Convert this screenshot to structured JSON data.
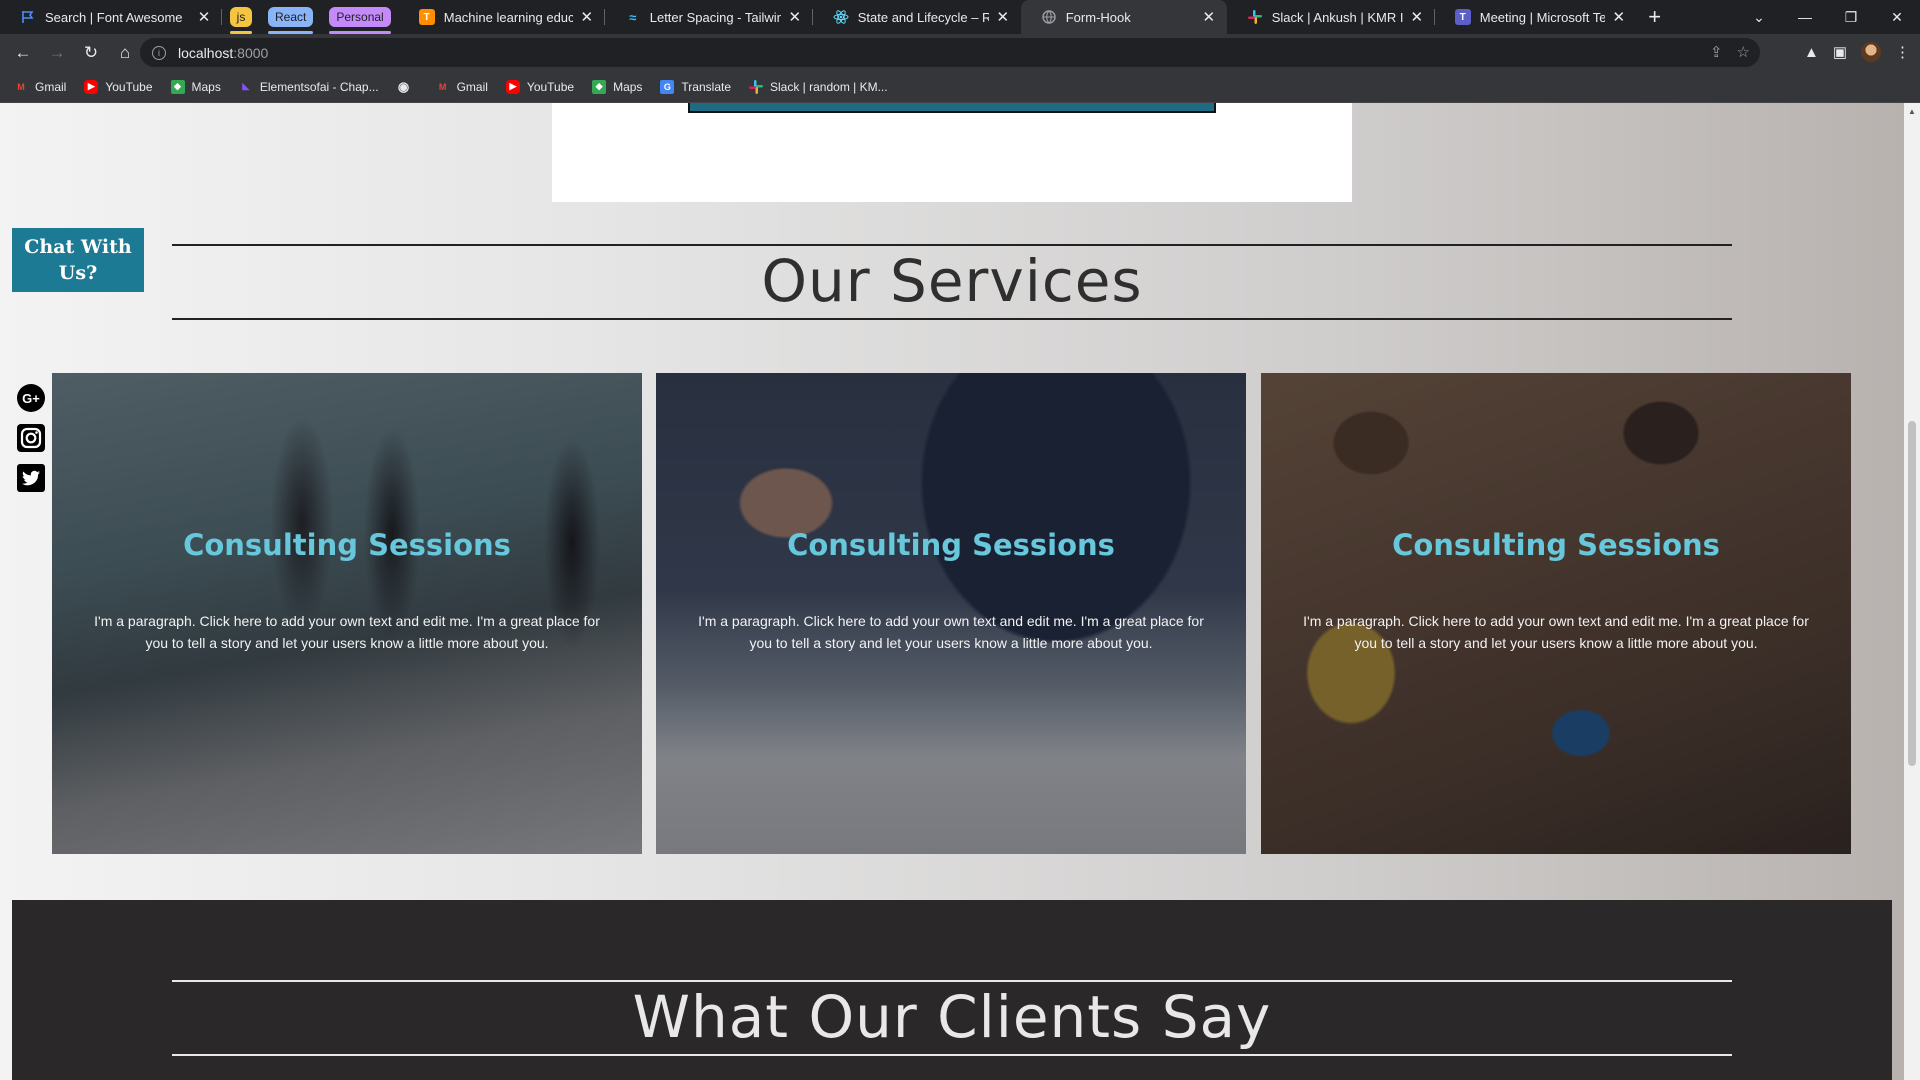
{
  "browser": {
    "tabs": [
      {
        "title": "Search | Font Awesome",
        "icon": "font-awesome-flag-icon"
      },
      {
        "group": "js",
        "color": "#f5c542",
        "text_color": "#202124"
      },
      {
        "group": "React",
        "color": "#8ab4f8",
        "text_color": "#202124"
      },
      {
        "group": "Personal",
        "color": "#c58af9",
        "text_color": "#202124"
      },
      {
        "title": "Machine learning educatio",
        "icon": "tensorflow-icon"
      },
      {
        "title": "Letter Spacing - Tailwind C",
        "icon": "tailwind-icon"
      },
      {
        "title": "State and Lifecycle – React",
        "icon": "react-icon"
      },
      {
        "title": "Form-Hook",
        "icon": "globe-icon",
        "active": true
      },
      {
        "title": "Slack | Ankush | KMR INFO",
        "icon": "slack-icon"
      },
      {
        "title": "Meeting | Microsoft Teams",
        "icon": "teams-icon"
      }
    ],
    "url_host": "localhost",
    "url_port": ":8000",
    "bookmarks": [
      {
        "label": "Gmail",
        "icon": "gmail-icon"
      },
      {
        "label": "YouTube",
        "icon": "youtube-icon"
      },
      {
        "label": "Maps",
        "icon": "maps-icon"
      },
      {
        "label": "Elementsofai - Chap...",
        "icon": "elementsofai-icon"
      },
      {
        "label": "",
        "icon": "globe-icon"
      },
      {
        "label": "Gmail",
        "icon": "gmail-icon"
      },
      {
        "label": "YouTube",
        "icon": "youtube-icon"
      },
      {
        "label": "Maps",
        "icon": "maps-icon"
      },
      {
        "label": "Translate",
        "icon": "translate-icon"
      },
      {
        "label": "Slack | random | KM...",
        "icon": "slack-icon"
      }
    ]
  },
  "page": {
    "chat_button": "Chat With Us?",
    "services_title": "Our Services",
    "socials": [
      "google-plus-icon",
      "instagram-icon",
      "twitter-icon"
    ],
    "cards": [
      {
        "title": "Consulting Sessions",
        "text": "I'm a paragraph. Click here to add your own text and edit me. I'm a great place for you to tell a story and let your users know a little more about you."
      },
      {
        "title": "Consulting Sessions",
        "text": "I'm a paragraph. Click here to add your own text and edit me. I'm a great place for you to tell a story and let your users know a little more about you."
      },
      {
        "title": "Consulting Sessions",
        "text": "I'm a paragraph. Click here to add your own text and edit me. I'm a great place for you to tell a story and let your users know a little more about you."
      }
    ],
    "clients_title": "What Our Clients Say"
  },
  "colors": {
    "accent": "#1d7a94",
    "card_title": "#67c7db",
    "clients_bg": "#2a2828"
  }
}
